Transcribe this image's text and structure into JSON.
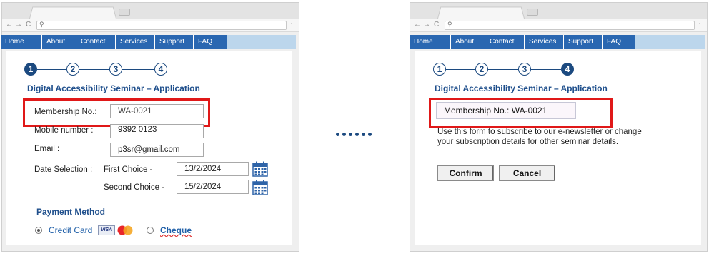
{
  "nav": {
    "items": [
      "Home",
      "About",
      "Contact",
      "Services",
      "Support",
      "FAQ"
    ]
  },
  "omnibox": {
    "search_glyph": "⚲"
  },
  "toolbar": {
    "back": "←",
    "forward": "→",
    "reload": "C",
    "menu": "⋮"
  },
  "left": {
    "steps": [
      "1",
      "2",
      "3",
      "4"
    ],
    "current_step": 1,
    "title": "Digital Accessibility Seminar – Application",
    "membership_label": "Membership No.:",
    "membership_value": "WA-0021",
    "mobile_label": "Mobile number :",
    "mobile_value": "9392 0123",
    "email_label": "Email :",
    "email_value": "p3sr@gmail.com",
    "date_label": "Date Selection :",
    "first_choice_label": "First Choice -",
    "first_choice_value": "13/2/2024",
    "second_choice_label": "Second Choice -",
    "second_choice_value": "15/2/2024",
    "payment_title": "Payment Method",
    "credit_card_label": "Credit Card",
    "cheque_label": "Cheque",
    "visa_text": "VISA",
    "selected_payment": "Credit Card"
  },
  "right": {
    "steps": [
      "1",
      "2",
      "3",
      "4"
    ],
    "current_step": 4,
    "title": "Digital Accessibility Seminar – Application",
    "membership_text": "Membership No.: WA-0021",
    "info_line1": "Use this form to subscribe to our e-newsletter or change",
    "info_line2": "your subscription details for other seminar details.",
    "confirm_label": "Confirm",
    "cancel_label": "Cancel"
  },
  "colors": {
    "nav_blue": "#2a67b1",
    "nav_light": "#bcd6ec",
    "title_blue": "#1f4f8c",
    "highlight_red": "#e01818"
  }
}
